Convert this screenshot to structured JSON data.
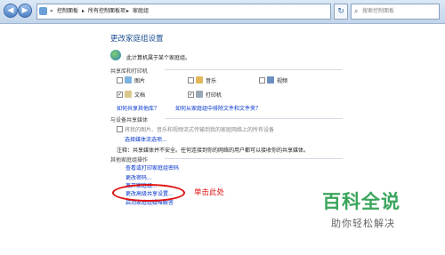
{
  "address": {
    "crumbs": [
      "«",
      "控制面板",
      "▸",
      "所有控制面板项",
      "▸",
      "家庭组"
    ],
    "search_placeholder": "搜索控制面板"
  },
  "page": {
    "title": "更改家庭组设置",
    "membership": "此计算机属于某个家庭组。",
    "share_section": "共享库和打印机",
    "libraries": [
      {
        "label": "图片",
        "checked": false
      },
      {
        "label": "音乐",
        "checked": false
      },
      {
        "label": "视频",
        "checked": false
      },
      {
        "label": "文档",
        "checked": true
      },
      {
        "label": "打印机",
        "checked": true
      }
    ],
    "share_link": "如何共享其他库？",
    "exclude_link": "如何从家庭组中排除文件和文件夹？",
    "media_section": "与设备共享媒体",
    "media_option": "将我的图片、音乐和视频流式传输到我的家庭网络上的所有设备",
    "media_link": "选择媒体流选项...",
    "note": "注释：共享媒体并不安全。任何连接到你的网络的用户都可以接收你的共享媒体。",
    "other_section": "其他家庭组操作",
    "actions": [
      "查看或打印家庭组密码",
      "更改密码...",
      "离开家庭组...",
      "更改高级共享设置...",
      "启动家庭组疑难解答"
    ],
    "annotation": "单击此处",
    "watermark_title": "百科全说",
    "watermark_sub": "助你轻松解决",
    "annotation_color": "#e01010"
  }
}
